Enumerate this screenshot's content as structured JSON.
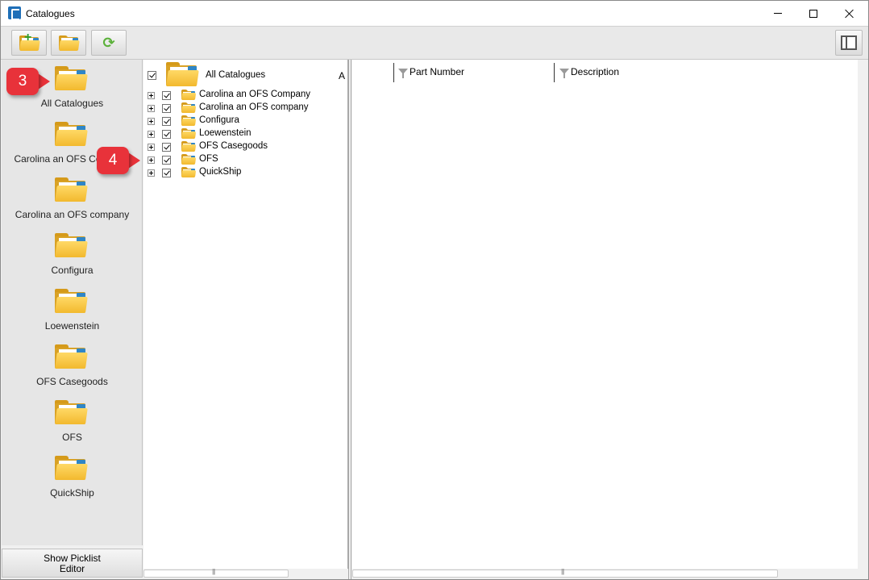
{
  "window": {
    "title": "Catalogues",
    "app_icon": "catalogue-app-icon"
  },
  "toolbar": {
    "buttons": [
      {
        "icon": "add-folder-icon"
      },
      {
        "icon": "open-folder-icon"
      },
      {
        "icon": "refresh-icon"
      }
    ],
    "panel_toggle_icon": "panel-layout-icon"
  },
  "sidebar": {
    "items": [
      {
        "label": "All Catalogues"
      },
      {
        "label": "Carolina an OFS Company"
      },
      {
        "label": "Carolina an OFS company"
      },
      {
        "label": "Configura"
      },
      {
        "label": "Loewenstein"
      },
      {
        "label": "OFS Casegoods"
      },
      {
        "label": "OFS"
      },
      {
        "label": "QuickShip"
      }
    ],
    "picklist_button_line1": "Show Picklist",
    "picklist_button_line2": "Editor"
  },
  "tree": {
    "root_label": "All Catalogues",
    "root_suffix": "A",
    "rows": [
      {
        "label": "Carolina an OFS Company",
        "checked": true
      },
      {
        "label": "Carolina an OFS company",
        "checked": true
      },
      {
        "label": "Configura",
        "checked": true
      },
      {
        "label": "Loewenstein",
        "checked": true
      },
      {
        "label": "OFS Casegoods",
        "checked": true
      },
      {
        "label": "OFS",
        "checked": true
      },
      {
        "label": "QuickShip",
        "checked": true
      }
    ]
  },
  "grid": {
    "columns": [
      {
        "label": "Part Number"
      },
      {
        "label": "Description"
      }
    ]
  },
  "callouts": [
    {
      "label": "3"
    },
    {
      "label": "4"
    }
  ],
  "colors": {
    "callout": "#e8323a",
    "folder": "#f2b92e"
  }
}
